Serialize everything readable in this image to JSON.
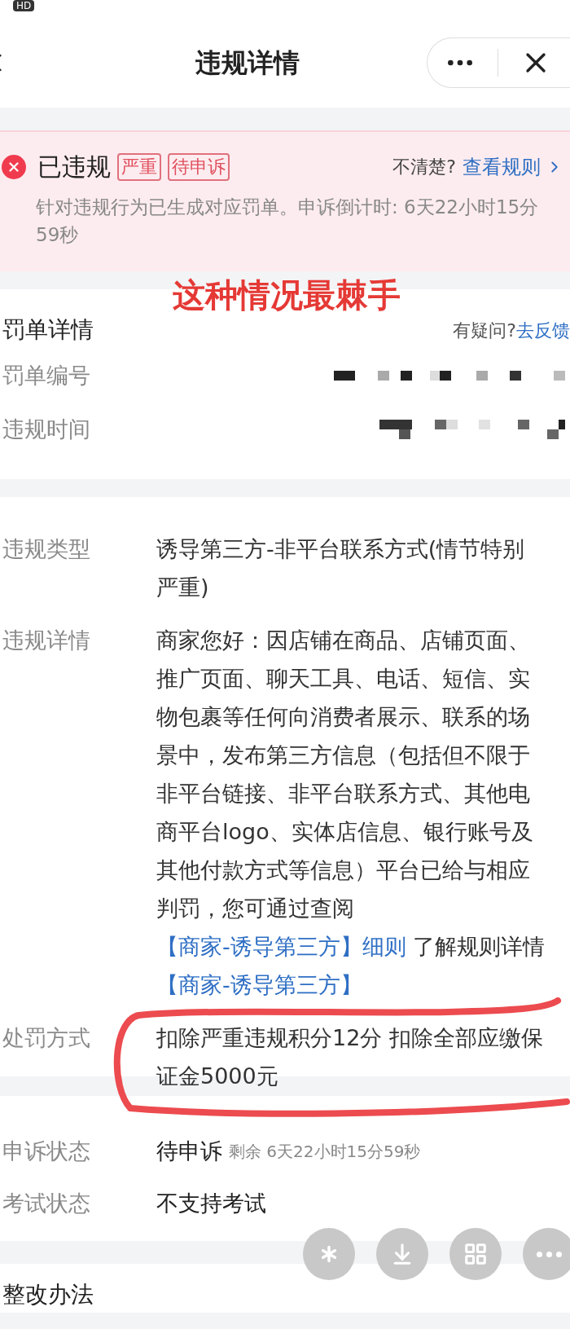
{
  "status_bar": {
    "badge": "HD"
  },
  "nav": {
    "title": "违规详情"
  },
  "banner": {
    "status": "已违规",
    "tags": [
      "严重",
      "待申诉"
    ],
    "help_prompt": "不清楚?",
    "help_link": "查看规则",
    "message": "针对违规行为已生成对应罚单。申诉倒计时: 6天22小时15分59秒"
  },
  "annotation": {
    "caption": "这种情况最棘手"
  },
  "penalty_card": {
    "title": "罚单详情",
    "feedback_prompt": "有疑问?",
    "feedback_link": "去反馈",
    "fields": [
      {
        "label": "罚单编号"
      },
      {
        "label": "违规时间"
      }
    ]
  },
  "violation_card": {
    "rows": [
      {
        "kind": "text",
        "label": "违规类型",
        "circled": false,
        "text": "诱导第三方-非平台联系方式(情节特别严重)"
      },
      {
        "kind": "rule",
        "label": "违规详情",
        "text": "商家您好：因店铺在商品、店铺页面、推广页面、聊天工具、电话、短信、实物包裹等任何向消费者展示、联系的场景中，发布第三方信息（包括但不限于非平台链接、非平台联系方式、其他电商平台logo、实体店信息、银行账号及其他付款方式等信息）平台已给与相应判罚，您可通过查阅",
        "link": "【商家-诱导第三方】细则",
        "suffix": "了解规则详情",
        "extra_link": "【商家-诱导第三方】"
      },
      {
        "kind": "text",
        "label": "处罚方式",
        "circled": true,
        "text": "扣除严重违规积分12分 扣除全部应缴保证金5000元"
      }
    ]
  },
  "appeal_card": {
    "rows": [
      {
        "label": "申诉状态",
        "value": "待申诉",
        "note": "剩余 6天22小时15分59秒"
      },
      {
        "label": "考试状态",
        "value": "不支持考试"
      }
    ]
  },
  "section": {
    "title": "整改办法"
  }
}
